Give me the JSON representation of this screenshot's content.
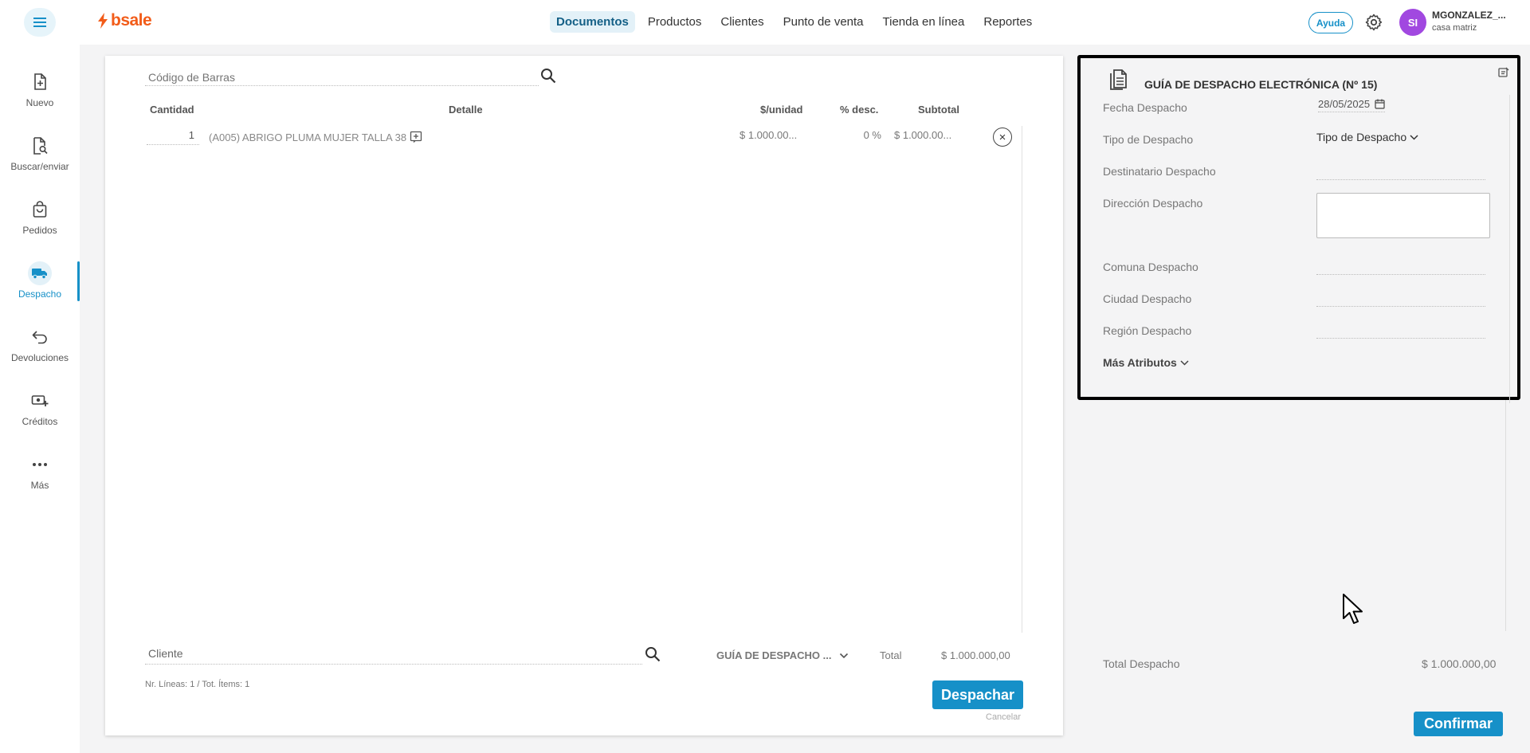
{
  "app": {
    "logo_text": "bsale",
    "brand_color": "#f25c19",
    "accent_color": "#1690c8"
  },
  "topnav": {
    "items": [
      {
        "label": "Documentos",
        "active": true
      },
      {
        "label": "Productos",
        "active": false
      },
      {
        "label": "Clientes",
        "active": false
      },
      {
        "label": "Punto de venta",
        "active": false
      },
      {
        "label": "Tienda en línea",
        "active": false
      },
      {
        "label": "Reportes",
        "active": false
      }
    ],
    "help_label": "Ayuda",
    "user_initials": "SI",
    "user_name": "MGONZALEZ_...",
    "user_branch": "casa matriz"
  },
  "sidebar": {
    "items": [
      {
        "label": "Nuevo",
        "icon": "file-plus-icon"
      },
      {
        "label": "Buscar/enviar",
        "icon": "file-search-icon"
      },
      {
        "label": "Pedidos",
        "icon": "bag-icon"
      },
      {
        "label": "Despacho",
        "icon": "truck-icon",
        "active": true
      },
      {
        "label": "Devoluciones",
        "icon": "return-icon"
      },
      {
        "label": "Créditos",
        "icon": "cash-plus-icon"
      },
      {
        "label": "Más",
        "icon": "more-icon"
      }
    ]
  },
  "document": {
    "barcode_placeholder": "Código de Barras",
    "columns": {
      "quantity": "Cantidad",
      "detail": "Detalle",
      "unit_price": "$/unidad",
      "discount": "% desc.",
      "subtotal": "Subtotal"
    },
    "rows": [
      {
        "quantity": "1",
        "detail": "(A005) ABRIGO PLUMA MUJER TALLA 38",
        "unit_price": "$ 1.000.00...",
        "discount": "0 %",
        "subtotal": "$ 1.000.00..."
      }
    ],
    "client_placeholder": "Cliente",
    "doc_type": "GUÍA DE DESPACHO ...",
    "total_label": "Total",
    "total_value": "$ 1.000.000,00",
    "lines_info": "Nr. Líneas: 1 / Tot. Ítems: 1",
    "dispatch_button": "Despachar",
    "cancel_link": "Cancelar"
  },
  "dispatch_panel": {
    "title": "GUÍA DE DESPACHO ELECTRÓNICA (Nº 15)",
    "fecha_label": "Fecha Despacho",
    "fecha_value": "28/05/2025",
    "tipo_label": "Tipo de Despacho",
    "tipo_value": "Tipo de Despacho",
    "destinatario_label": "Destinatario Despacho",
    "direccion_label": "Dirección Despacho",
    "comuna_label": "Comuna Despacho",
    "ciudad_label": "Ciudad Despacho",
    "region_label": "Región Despacho",
    "more_attributes": "Más Atributos",
    "total_label": "Total Despacho",
    "total_value": "$ 1.000.000,00",
    "confirm_button": "Confirmar"
  }
}
